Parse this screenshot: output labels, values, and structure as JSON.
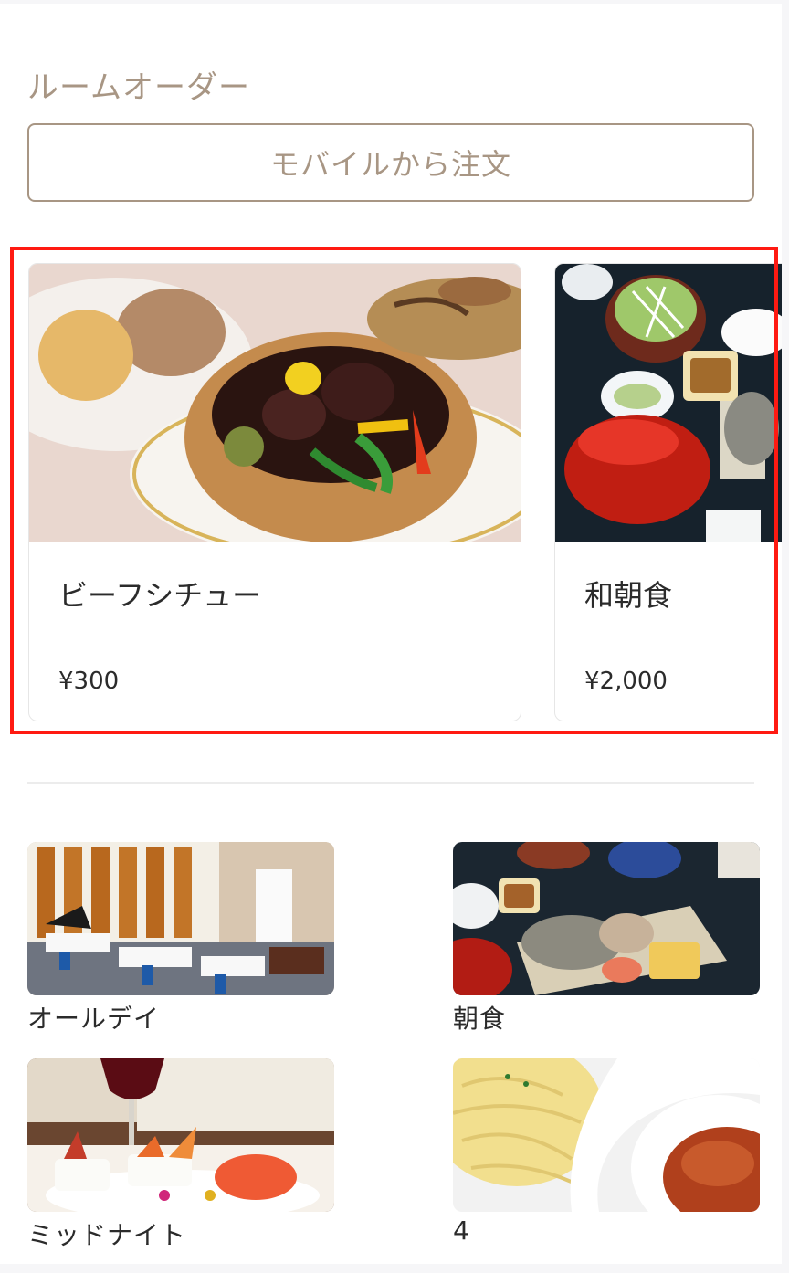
{
  "room_order": {
    "title": "ルームオーダー",
    "mobile_order_button": "モバイルから注文"
  },
  "featured_menu": [
    {
      "name": "ビーフシチュー",
      "price": "¥300",
      "image": "beef-stew-photo"
    },
    {
      "name": "和朝食",
      "price": "¥2,000",
      "image": "japanese-breakfast-photo"
    }
  ],
  "categories": [
    {
      "label": "オールデイ",
      "image": "restaurant-dining-hall-photo"
    },
    {
      "label": "朝食",
      "image": "grilled-fish-breakfast-photo"
    },
    {
      "label": "ミッドナイト",
      "image": "wine-appetizer-photo"
    },
    {
      "label": "4",
      "image": "pasta-photo"
    }
  ],
  "colors": {
    "accent": "#a89684",
    "highlight_border": "#ff1a12",
    "text": "#2b2b2b"
  }
}
